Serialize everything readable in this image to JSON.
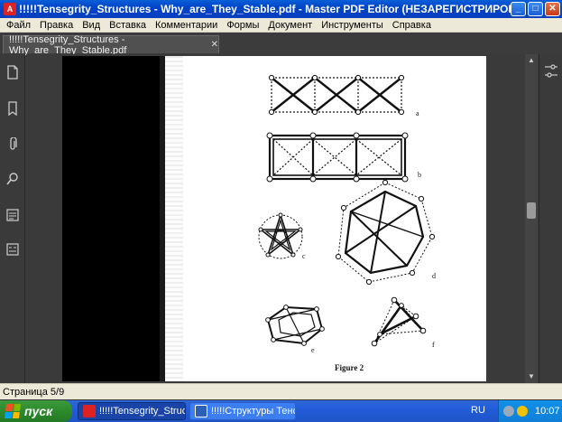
{
  "window": {
    "title": "!!!!!Tensegrity_Structures - Why_are_They_Stable.pdf - Master PDF Editor (НЕЗАРЕГИСТРИРОВАННАЯ ВЕРСИЯ)",
    "minimize": "_",
    "maximize": "□",
    "close": "✕"
  },
  "menu": {
    "items": [
      "Файл",
      "Правка",
      "Вид",
      "Вставка",
      "Комментарии",
      "Формы",
      "Документ",
      "Инструменты",
      "Справка"
    ]
  },
  "tabs": [
    {
      "label": "!!!!!Tensegrity_Structures - Why_are_They_Stable.pdf",
      "close": "✕"
    }
  ],
  "left_tools": [
    {
      "name": "page-thumbnails-icon"
    },
    {
      "name": "bookmark-icon"
    },
    {
      "name": "attachment-icon"
    },
    {
      "name": "search-icon"
    },
    {
      "name": "layers-icon"
    },
    {
      "name": "fields-icon"
    }
  ],
  "document": {
    "figure_labels": {
      "a": "a",
      "b": "b",
      "c": "c",
      "d": "d",
      "e": "e",
      "f": "f"
    },
    "caption": "Figure 2"
  },
  "status": {
    "page": "Страница 5/9"
  },
  "taskbar": {
    "start_label": "пуск",
    "buttons": [
      {
        "label": "!!!!!Tensegrity_Structu...",
        "active": true
      },
      {
        "label": "!!!!!Структуры Тенс...",
        "active": false
      }
    ],
    "language": "RU",
    "clock": "10:07"
  },
  "colors": {
    "title_bar": "#0a5fd8",
    "menu_bg": "#ece9d8",
    "app_bg": "#3a3a3a",
    "taskbar": "#245edb",
    "start_button": "#2d8a2d",
    "tray": "#0f7fd8"
  }
}
